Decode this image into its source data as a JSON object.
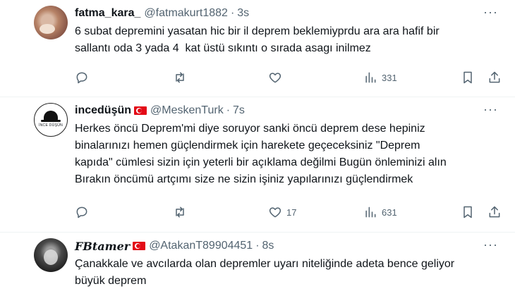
{
  "tweets": [
    {
      "display_name": "fatma_kara_",
      "handle": "@fatmakurt1882",
      "separator": "·",
      "time": "3s",
      "text": "6 subat depremini yasatan hic bir il deprem beklemiyprdu ara ara hafif bir\nsallantı oda 3 yada 4  kat üstü sıkıntı o sırada asagı inilmez",
      "avatar_icon": "cat-photo-avatar",
      "has_flag": false,
      "actions": {
        "reply": "",
        "retweet": "",
        "like": "",
        "views": "331"
      }
    },
    {
      "display_name": "incedüşün",
      "handle": "@MeskenTurk",
      "separator": "·",
      "time": "7s",
      "text": "Herkes öncü Deprem'mi diye soruyor sanki öncü deprem dese hepiniz\nbinalarınızı hemen güçlendirmek için harekete geçeceksiniz \"Deprem\nkapıda\" cümlesi sizin için yeterli bir açıklama değilmi Bugün önleminizi alın\nBırakın öncümü artçımı size ne sizin işiniz yapılarınızı güçlendirmek",
      "avatar_icon": "hat-logo-avatar",
      "avatar_text": "İNCE DÜŞÜN",
      "has_flag": true,
      "actions": {
        "reply": "",
        "retweet": "",
        "like": "17",
        "views": "631"
      }
    },
    {
      "display_name": "FBtamer",
      "handle": "@AtakanT89904451",
      "separator": "·",
      "time": "8s",
      "text": "Çanakkale ve avcılarda olan depremler uyarı niteliğinde adeta bence geliyor\nbüyük deprem",
      "avatar_icon": "dark-photo-avatar",
      "has_flag": true
    }
  ],
  "icons": {
    "more": "more-dots-icon",
    "reply": "reply-icon",
    "retweet": "retweet-icon",
    "like": "heart-icon",
    "views": "views-chart-icon",
    "bookmark": "bookmark-icon",
    "share": "share-icon",
    "flag": "turkey-flag-icon"
  },
  "colors": {
    "text": "#0f1419",
    "secondary": "#536471",
    "divider": "#eff3f4",
    "flag_red": "#e30a17"
  }
}
